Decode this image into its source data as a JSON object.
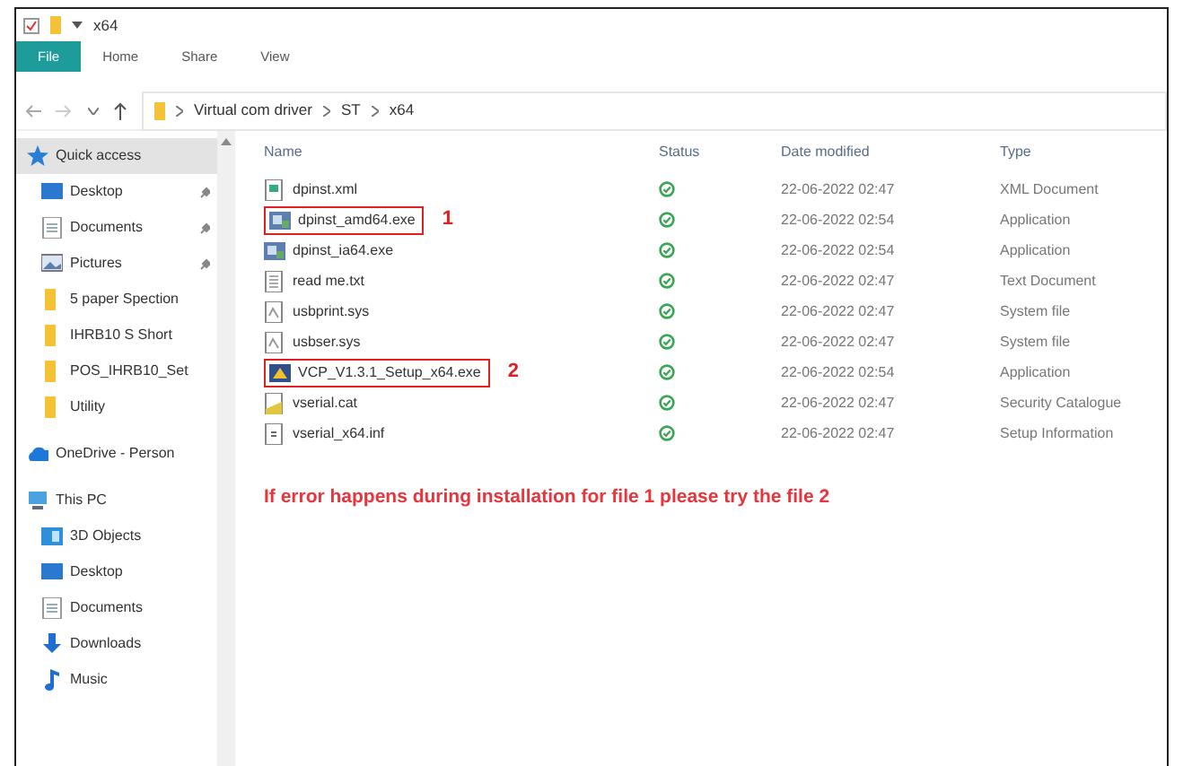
{
  "window": {
    "title": "x64"
  },
  "ribbon_tabs": [
    {
      "label": "File",
      "selected": true
    },
    {
      "label": "Home",
      "selected": false
    },
    {
      "label": "Share",
      "selected": false
    },
    {
      "label": "View",
      "selected": false
    }
  ],
  "address_bar": {
    "path": [
      "Virtual com driver",
      "ST",
      "x64"
    ]
  },
  "sidebar": {
    "sections": [
      {
        "label": "Quick access",
        "kind": "star",
        "selected": true,
        "children": [
          {
            "label": "Desktop",
            "kind": "desktop",
            "pinned": true
          },
          {
            "label": "Documents",
            "kind": "documents",
            "pinned": true
          },
          {
            "label": "Pictures",
            "kind": "pictures",
            "pinned": true
          },
          {
            "label": "5 paper Spection",
            "kind": "folder",
            "pinned": false
          },
          {
            "label": "IHRB10 S Short",
            "kind": "folder",
            "pinned": false
          },
          {
            "label": "POS_IHRB10_Set",
            "kind": "folder",
            "pinned": false
          },
          {
            "label": "Utility",
            "kind": "folder",
            "pinned": false
          }
        ]
      },
      {
        "label": "OneDrive - Person",
        "kind": "cloud",
        "selected": false
      },
      {
        "label": "This PC",
        "kind": "pc",
        "selected": false,
        "children": [
          {
            "label": "3D Objects",
            "kind": "cube",
            "pinned": false
          },
          {
            "label": "Desktop",
            "kind": "desktop",
            "pinned": false
          },
          {
            "label": "Documents",
            "kind": "documents",
            "pinned": false
          },
          {
            "label": "Downloads",
            "kind": "download",
            "pinned": false
          },
          {
            "label": "Music",
            "kind": "music",
            "pinned": false
          }
        ]
      }
    ]
  },
  "table": {
    "columns": [
      "Name",
      "Status",
      "Date modified",
      "Type"
    ],
    "rows": [
      {
        "name": "dpinst.xml",
        "kind": "xml",
        "date": "22-06-2022 02:47",
        "type": "XML Document"
      },
      {
        "name": "dpinst_amd64.exe",
        "kind": "app",
        "date": "22-06-2022 02:54",
        "type": "Application",
        "callout": "1"
      },
      {
        "name": "dpinst_ia64.exe",
        "kind": "app",
        "date": "22-06-2022 02:54",
        "type": "Application"
      },
      {
        "name": "read me.txt",
        "kind": "text",
        "date": "22-06-2022 02:47",
        "type": "Text Document"
      },
      {
        "name": "usbprint.sys",
        "kind": "sys",
        "date": "22-06-2022 02:47",
        "type": "System file"
      },
      {
        "name": "usbser.sys",
        "kind": "sys",
        "date": "22-06-2022 02:47",
        "type": "System file"
      },
      {
        "name": "VCP_V1.3.1_Setup_x64.exe",
        "kind": "setup",
        "date": "22-06-2022 02:54",
        "type": "Application",
        "callout": "2"
      },
      {
        "name": "vserial.cat",
        "kind": "cat",
        "date": "22-06-2022 02:47",
        "type": "Security Catalogue"
      },
      {
        "name": "vserial_x64.inf",
        "kind": "inf",
        "date": "22-06-2022 02:47",
        "type": "Setup Information"
      }
    ]
  },
  "note": "If error happens during installation for file 1 please try the file 2"
}
